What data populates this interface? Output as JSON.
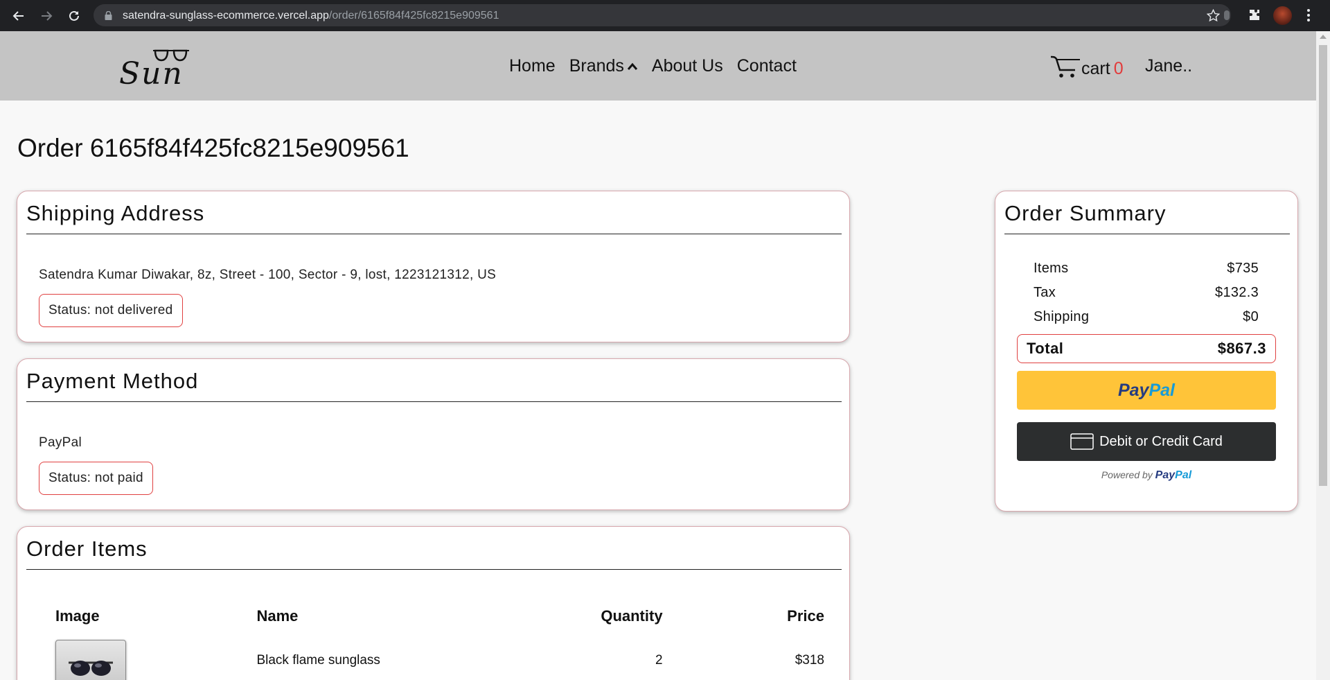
{
  "browser": {
    "url_host": "satendra-sunglass-ecommerce.vercel.app",
    "url_path": "/order/6165f84f425fc8215e909561"
  },
  "header": {
    "logo_text": "Sun",
    "nav": {
      "home": "Home",
      "brands": "Brands",
      "about": "About Us",
      "contact": "Contact"
    },
    "cart_label": "cart",
    "cart_count": "0",
    "user": "Jane.."
  },
  "page": {
    "title": "Order 6165f84f425fc8215e909561"
  },
  "shipping": {
    "heading": "Shipping Address",
    "address": "Satendra Kumar Diwakar, 8z, Street - 100, Sector - 9, lost, 1223121312, US",
    "status": "Status: not delivered"
  },
  "payment": {
    "heading": "Payment Method",
    "method": "PayPal",
    "status": "Status: not paid"
  },
  "order_items": {
    "heading": "Order Items",
    "columns": [
      "Image",
      "Name",
      "Quantity",
      "Price"
    ],
    "rows": [
      {
        "name": "Black flame sunglass",
        "quantity": "2",
        "price": "$318"
      }
    ]
  },
  "summary": {
    "heading": "Order Summary",
    "items_label": "Items",
    "items_value": "$735",
    "tax_label": "Tax",
    "tax_value": "$132.3",
    "shipping_label": "Shipping",
    "shipping_value": "$0",
    "total_label": "Total",
    "total_value": "$867.3",
    "paypal_pay": "Pay",
    "paypal_pal": "Pal",
    "card_button": "Debit or Credit Card",
    "powered_by": "Powered by",
    "powered_pay": "Pay",
    "powered_pal": "Pal"
  },
  "colors": {
    "header_bg": "#c4c4c4",
    "status_border": "#e04040",
    "cart_count": "#e23b3b",
    "paypal_yellow": "#ffc439",
    "card_button_bg": "#2c2e2f"
  }
}
